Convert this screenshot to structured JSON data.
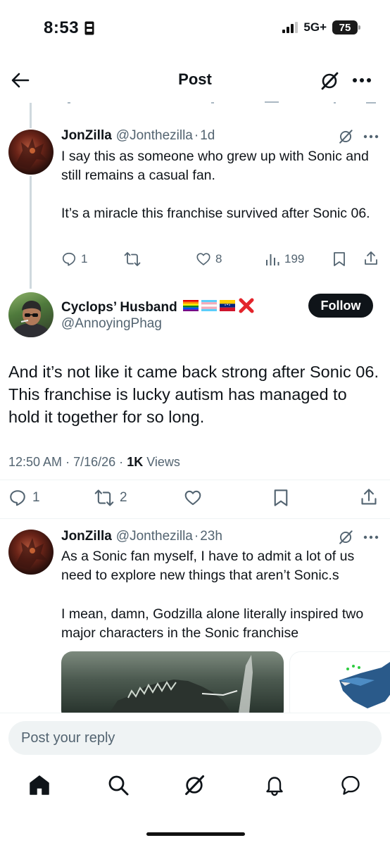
{
  "status_bar": {
    "time": "8:53",
    "network": "5G+",
    "battery": "75"
  },
  "header": {
    "title": "Post",
    "back_icon": "arrow-left-icon",
    "grok_icon": "grok-icon",
    "more_icon": "more-icon"
  },
  "thread": {
    "parent_reply": {
      "name": "JonZilla",
      "handle": "@Jonthezilla",
      "dot": "·",
      "time": "1d",
      "text_line1": "I say this as someone who grew up with Sonic and still remains a casual fan.",
      "text_line2": "It’s a miracle this franchise survived after Sonic 06.",
      "replies": "1",
      "likes": "8",
      "views": "199"
    }
  },
  "main_post": {
    "name": "Cyclops’ Husband",
    "handle": "@AnnoyingPhag",
    "follow_label": "Follow",
    "text": "And it’s not like it came back strong after Sonic 06. This franchise is lucky autism has managed to hold it together for so long.",
    "time": "12:50 AM",
    "date": "7/16/26",
    "views_count": "1K",
    "views_label": "Views",
    "dot": "·",
    "replies": "1",
    "reposts": "2"
  },
  "reply": {
    "name": "JonZilla",
    "handle": "@Jonthezilla",
    "dot": "·",
    "time": "23h",
    "text_line1": "As a Sonic fan myself, I have to admit a lot of us need to explore new things that aren’t Sonic.s",
    "text_line2": "I mean, damn, Godzilla alone literally inspired two major characters in the Sonic franchise"
  },
  "compose": {
    "placeholder": "Post your reply"
  },
  "colors": {
    "text": "#0f1419",
    "muted": "#536471",
    "divider": "#eff3f4",
    "thread_line": "#cfd9de",
    "button": "#0f1419"
  }
}
